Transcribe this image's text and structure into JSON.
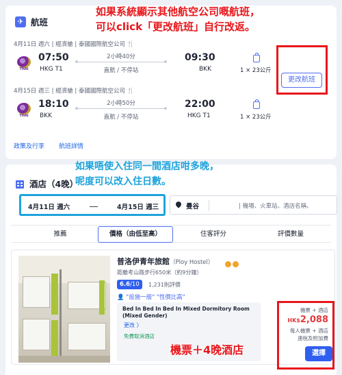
{
  "flight": {
    "title": "航班",
    "segments": [
      {
        "meta": "4月11日 週六  |  經濟艙  |  泰國國際航空公司 🍴",
        "logo_text": "THAI",
        "dep_time": "07:50",
        "dep_airport": "HKG T1",
        "duration": "2小時40分",
        "stops": "直航 / 不停站",
        "arr_time": "09:30",
        "arr_airport": "BKK",
        "baggage": "1 × 23公斤"
      },
      {
        "meta": "4月15日 週三  |  經濟艙  |  泰國國際航空公司 🍴",
        "logo_text": "THAI",
        "dep_time": "18:10",
        "dep_airport": "BKK",
        "duration": "2小時50分",
        "stops": "直航 / 不停站",
        "arr_time": "22:00",
        "arr_airport": "HKG T1",
        "baggage": "1 × 23公斤"
      }
    ],
    "change_button": "更改航班",
    "policy_link": "政策及行李",
    "details_link": "航班詳情"
  },
  "hotel": {
    "title": "酒店（4晚）",
    "checkin": "4月11日 週六",
    "checkout": "4月15日 週三",
    "destination": "曼谷",
    "destination_placeholder": "| 機場、火車站、酒店名稱、",
    "tabs": [
      "推薦",
      "價格（由低至高）",
      "住客評分",
      "評價數量"
    ],
    "active_tab": 1,
    "item": {
      "name": "普洛伊青年旅館",
      "name_en": "（Ploy Hostel）",
      "distance": "距離考山路步行650米（約9分鐘）",
      "score": "6.6",
      "score_out": "/10",
      "reviews": "1,231則評價",
      "features": "👤 \"設施一般\" \"性價比高\"",
      "room": "Bed In Bed In Bed In Mixed Dormitory Room (Mixed Gender)",
      "more": "更改  〉",
      "free_cancel": "免費取消酒店",
      "price_label": "機票 + 酒店",
      "currency": "HK$",
      "price": "2,088",
      "per_person": "每人機票 + 酒店",
      "taxes": "連稅及附加費",
      "select_button": "選擇"
    }
  },
  "annotations": {
    "top_line1": "如果系統顯示其他航空公司嘅航班，",
    "top_line2": "可以click「更改航班」自行改返。",
    "mid_line1": "如果唔使入住同一間酒店咁多晚，",
    "mid_line2": "呢度可以改入住日數。",
    "bottom": "機票＋4晚酒店"
  },
  "colors": {
    "accent": "#4e6ef2",
    "annotation_red": "#e8161b",
    "annotation_blue": "#1ea3dc",
    "price": "#e4393c"
  }
}
